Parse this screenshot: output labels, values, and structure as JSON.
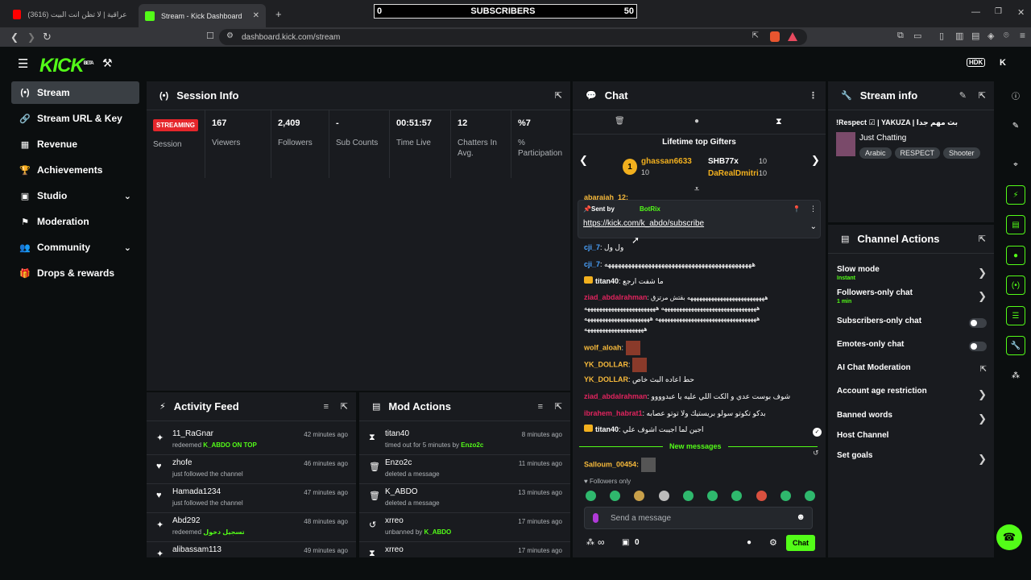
{
  "browser": {
    "tabs": [
      {
        "title": "(3616) اغاني عراقية | لا تظن انت البيت"
      },
      {
        "title": "Stream - Kick Dashboard"
      }
    ],
    "new_tab": "+",
    "url": "dashboard.kick.com/stream"
  },
  "overlay": {
    "left": "0",
    "title": "SUBSCRIBERS",
    "right": "50"
  },
  "header": {
    "logo": "KICK",
    "beta": "BETA",
    "user_initial": "K",
    "badge": "HDK"
  },
  "sidebar": {
    "items": [
      {
        "label": "Stream",
        "icon": "(•)"
      },
      {
        "label": "Stream URL & Key",
        "icon": "🔗"
      },
      {
        "label": "Revenue",
        "icon": "▦"
      },
      {
        "label": "Achievements",
        "icon": "🏆"
      },
      {
        "label": "Studio",
        "icon": "▣"
      },
      {
        "label": "Moderation",
        "icon": "⚑"
      },
      {
        "label": "Community",
        "icon": "👥"
      },
      {
        "label": "Drops & rewards",
        "icon": "🎁"
      }
    ]
  },
  "session": {
    "title": "Session Info",
    "status": "STREAMING",
    "status_label": "Session",
    "stats": [
      {
        "value": "167",
        "label": "Viewers"
      },
      {
        "value": "2,409",
        "label": "Followers"
      },
      {
        "value": "-",
        "label": "Sub Counts"
      },
      {
        "value": "00:51:57",
        "label": "Time Live"
      },
      {
        "value": "12",
        "label": "Chatters In Avg."
      },
      {
        "value": "%7",
        "label": "% Participation"
      }
    ]
  },
  "activity": {
    "title": "Activity Feed",
    "items": [
      {
        "name": "11_RaGnar",
        "desc": "redeemed ",
        "highlight": "K_ABDO ON TOP",
        "time": "42 minutes ago",
        "icon": "✦"
      },
      {
        "name": "zhofe",
        "desc": "just followed the channel",
        "highlight": "",
        "time": "46 minutes ago",
        "icon": "♥"
      },
      {
        "name": "Hamada1234",
        "desc": "just followed the channel",
        "highlight": "",
        "time": "47 minutes ago",
        "icon": "♥"
      },
      {
        "name": "Abd292",
        "desc": "redeemed ",
        "highlight": "تسجيل دخول",
        "time": "48 minutes ago",
        "icon": "✦"
      },
      {
        "name": "alibassam113",
        "desc": "",
        "highlight": "",
        "time": "49 minutes ago",
        "icon": "✦"
      }
    ]
  },
  "mod": {
    "title": "Mod Actions",
    "items": [
      {
        "name": "titan40",
        "desc": "timed out for 5 minutes by ",
        "highlight": "Enzo2c",
        "time": "8 minutes ago",
        "icon": "⧗"
      },
      {
        "name": "Enzo2c",
        "desc": "deleted a message",
        "highlight": "",
        "time": "11 minutes ago",
        "icon": "🗑"
      },
      {
        "name": "K_ABDO",
        "desc": "deleted a message",
        "highlight": "",
        "time": "13 minutes ago",
        "icon": "🗑"
      },
      {
        "name": "xrreo",
        "desc": "unbanned by ",
        "highlight": "K_ABDO",
        "time": "17 minutes ago",
        "icon": "↺"
      },
      {
        "name": "xrreo",
        "desc": "",
        "highlight": "",
        "time": "17 minutes ago",
        "icon": "⧗"
      }
    ]
  },
  "chat": {
    "title": "Chat",
    "gifters_title": "Lifetime top Gifters",
    "gifters": [
      {
        "name": "ghassan6633",
        "count": "10"
      },
      {
        "name": "SHB77x",
        "count": "10"
      },
      {
        "name": "DaRealDmitri",
        "count": "10"
      }
    ],
    "rank": "1",
    "pinned_user": "abaraiah_12:",
    "pinned_by_label": "Sent by",
    "pinned_by": "BotRix",
    "pinned_link": "https://kick.com/k_abdo/subscribe",
    "messages": [
      {
        "user": "cji_7",
        "color": "#4aa3ff",
        "text": "ول ول"
      },
      {
        "user": "cji_7",
        "color": "#4aa3ff",
        "text": "ههههههههههههههههههههههههههههههههههههههههههههه"
      },
      {
        "user": "titan40",
        "color": "#ffffff",
        "text": "ما شفت ارجع"
      },
      {
        "user": "ziad_abdalrahman",
        "color": "#e0245e",
        "text": "ههههههههههههههههههههههههههه بقتش مرتزق ههههههههههههههههههههههههههههههههه ههههههههههههههههههههههههه ههههههههههههههههههههههههههههههههههه ههههههههههههههههههههههه ههههههههههههههههههههه"
      },
      {
        "user": "wolf_aloah",
        "color": "#f6b93b",
        "text": ""
      },
      {
        "user": "YK_DOLLAR",
        "color": "#f6b93b",
        "text": ""
      },
      {
        "user": "YK_DOLLAR",
        "color": "#f6b93b",
        "text": "حط اعاده البث خاص"
      },
      {
        "user": "ziad_abdalrahman",
        "color": "#e0245e",
        "text": "شوف بوست عدي و الكت اللي عليه يا عبدوووو"
      },
      {
        "user": "ibrahem_habrat1",
        "color": "#e0245e",
        "text": "بدكو تكوتو سولو بريستيك ولا توتو عصابه"
      },
      {
        "user": "titan40",
        "color": "#ffffff",
        "text": "اجين لما اجيبت اشوف علي"
      }
    ],
    "new_messages": "New messages",
    "last_user": "Salloum_00454:",
    "followers_only": "Followers only",
    "input_placeholder": "Send a message",
    "viewers_inf": "∞",
    "count_zero": "0",
    "send_label": "Chat"
  },
  "stream_info": {
    "title": "Stream info",
    "stream_title": "!Respect ☑ | YAKUZA | بث مهم جدا",
    "category": "Just Chatting",
    "tags": [
      "Arabic",
      "RESPECT",
      "Shooter"
    ]
  },
  "channel_actions": {
    "title": "Channel Actions",
    "rows": [
      {
        "label": "Slow mode",
        "sub": "Instant",
        "kind": "arrow"
      },
      {
        "label": "Followers-only chat",
        "sub": "1 min",
        "kind": "arrow"
      },
      {
        "label": "Subscribers-only chat",
        "sub": "",
        "kind": "toggle"
      },
      {
        "label": "Emotes-only chat",
        "sub": "",
        "kind": "toggle"
      },
      {
        "label": "AI Chat Moderation",
        "sub": "",
        "kind": "external"
      },
      {
        "label": "Account age restriction",
        "sub": "",
        "kind": "arrow"
      },
      {
        "label": "Banned words",
        "sub": "",
        "kind": "arrow"
      },
      {
        "label": "Host Channel",
        "sub": "",
        "kind": "none"
      },
      {
        "label": "Set goals",
        "sub": "",
        "kind": "arrow"
      }
    ]
  },
  "colors": {
    "accent": "#53fc18",
    "panel": "#191b1f",
    "background": "#0b0e0f"
  }
}
